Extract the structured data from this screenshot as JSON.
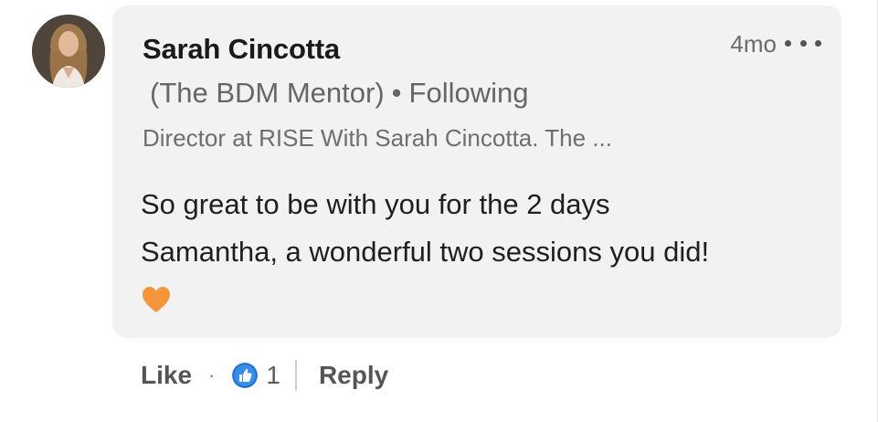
{
  "comment": {
    "author_name": "Sarah Cincotta",
    "author_subtitle": "(The BDM Mentor)",
    "separator": "•",
    "follow_status": "Following",
    "headline": "Director at RISE With Sarah Cincotta. The ...",
    "timestamp": "4mo",
    "body_lines": [
      "So great to be with you for the 2 days",
      "Samantha, a wonderful two sessions you did!"
    ],
    "emoji": "orange-heart"
  },
  "actions": {
    "like_label": "Like",
    "separator": "·",
    "reaction_icon": "thumbs-up-icon",
    "reaction_count": "1",
    "reply_label": "Reply"
  },
  "colors": {
    "bubble_background": "#f2f2f2",
    "heart": "#f5953a",
    "like_icon": "#378fe9"
  }
}
